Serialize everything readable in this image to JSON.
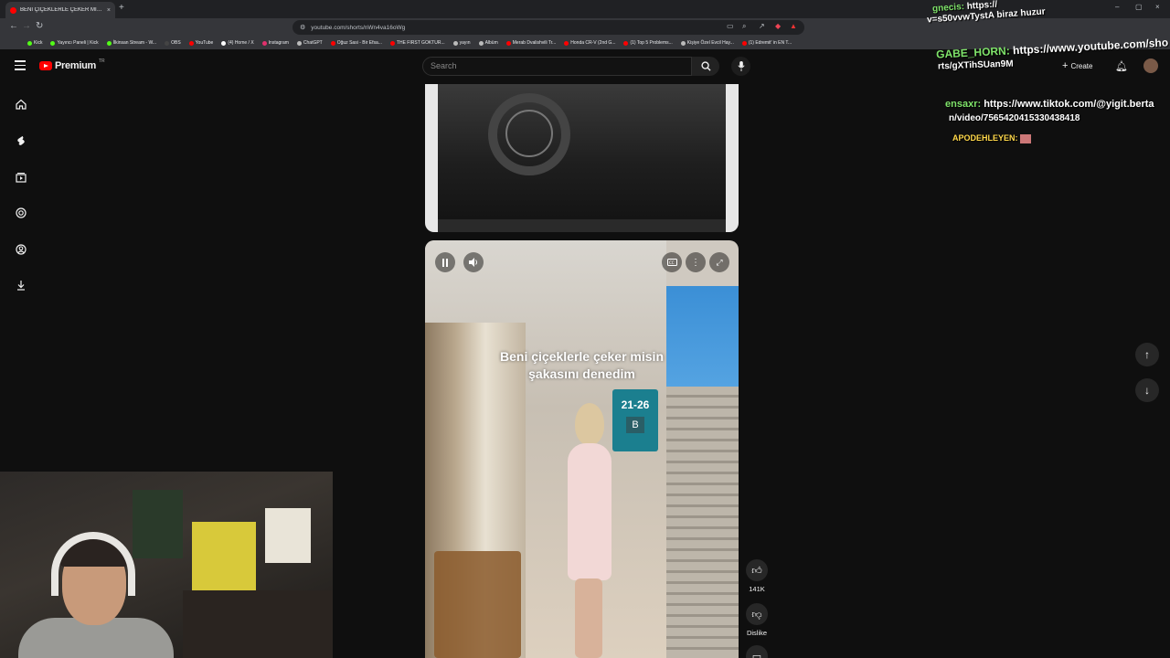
{
  "browser": {
    "tab_title": "BENİ ÇİÇEKLERLE ÇEKER MİSİN",
    "tab_close": "×",
    "new_tab": "+",
    "url": "youtube.com/shorts/nWn4va16oWg",
    "window_controls": [
      "–",
      "▢",
      "×"
    ],
    "bookmarks": [
      {
        "label": "Kick",
        "color": "#53fc18"
      },
      {
        "label": "Yayıncı Paneli | Kick",
        "color": "#53fc18"
      },
      {
        "label": "İlkinsan Stream - W...",
        "color": "#53fc18"
      },
      {
        "label": "OBS",
        "color": "#444444"
      },
      {
        "label": "YouTube",
        "color": "#ff0000"
      },
      {
        "label": "(4) Home / X",
        "color": "#ffffff"
      },
      {
        "label": "Instagram",
        "color": "#e1306c"
      },
      {
        "label": "ChatGPT",
        "color": "#bbbbbb"
      },
      {
        "label": "Oğuz Sasi - Bir Efsa...",
        "color": "#ff0000"
      },
      {
        "label": "THE FIRST GOKTUR...",
        "color": "#ff0000"
      },
      {
        "label": "yayın",
        "color": "#bbbbbb"
      },
      {
        "label": "Albüm",
        "color": "#bbbbbb"
      },
      {
        "label": "Merab Dvalishvili Tr...",
        "color": "#ff0000"
      },
      {
        "label": "Honda CR-V (2nd G...",
        "color": "#ff0000"
      },
      {
        "label": "(1) Top 5 Problems...",
        "color": "#ff0000"
      },
      {
        "label": "Kişiye Özel Evcil Hay...",
        "color": "#bbbbbb"
      },
      {
        "label": "(1) Edremit' in EN T...",
        "color": "#ff0000"
      }
    ]
  },
  "youtube": {
    "logo_text": "Premium",
    "logo_region": "TR",
    "search_placeholder": "Search",
    "create_label": "Create",
    "sidebar_icons": [
      "home-icon",
      "shorts-icon",
      "subscriptions-icon",
      "you-icon",
      "account-icon",
      "downloads-icon"
    ],
    "short": {
      "caption_line1": "Beni çiçeklerle çeker misin",
      "caption_line2": "şakasını denedim",
      "sign_number": "21-26",
      "sign_letter": "B"
    },
    "actions": {
      "like_count": "141K",
      "dislike_label": "Dislike"
    }
  },
  "chat": {
    "lines": [
      {
        "user": "gnecis:",
        "text": "https://",
        "user_color": "#7fe36a"
      },
      {
        "user": "",
        "text": "v=s50vvwTystA biraz huzur",
        "user_color": "#7fe36a"
      },
      {
        "user": "GABE_HORN:",
        "text": "https://www.youtube.com/sho",
        "user_color": "#7fe36a"
      },
      {
        "user": "",
        "text": "rts/gXTihSUan9M",
        "user_color": "#7fe36a"
      },
      {
        "user": "ensaxr:",
        "text": "https://www.tiktok.com/@yigit.berta",
        "user_color": "#7fe36a"
      },
      {
        "user": "",
        "text": "n/video/7565420415330438418",
        "user_color": "#7fe36a"
      },
      {
        "user": "APODEHLEYEN:",
        "text": "",
        "user_color": "#ffd84a"
      }
    ]
  }
}
